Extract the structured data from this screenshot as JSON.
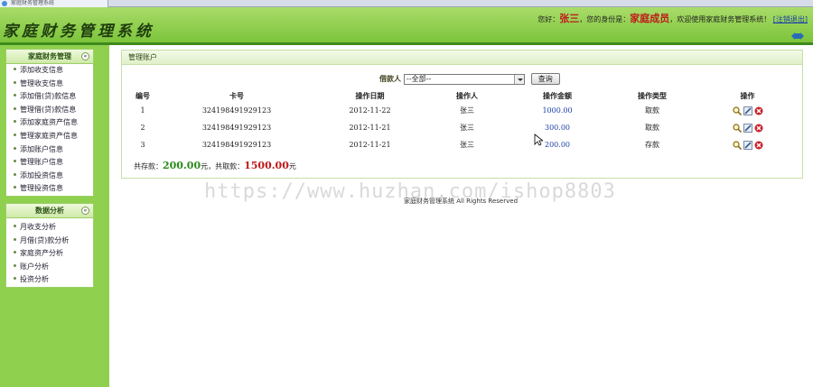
{
  "window": {
    "tab_title": "家庭财务管理系统"
  },
  "header": {
    "logo": "家庭财务管理系统",
    "greeting_prefix": "您好：",
    "username": "张三",
    "role_prefix": "，您的身份是：",
    "role": "家庭成员",
    "welcome": "，欢迎使用家庭财务管理系统！",
    "logout": "[注销退出]"
  },
  "sidebar": {
    "groups": [
      {
        "title": "家庭财务管理",
        "items": [
          "添加收支信息",
          "管理收支信息",
          "添加借(贷)款信息",
          "管理借(贷)款信息",
          "添加家庭资产信息",
          "管理家庭资产信息",
          "添加账户信息",
          "管理账户信息",
          "添加投资信息",
          "管理投资信息"
        ]
      },
      {
        "title": "数据分析",
        "items": [
          "月收支分析",
          "月借(贷)款分析",
          "家庭资产分析",
          "账户分析",
          "投资分析"
        ]
      }
    ]
  },
  "main": {
    "title": "管理账户",
    "search": {
      "label": "借款人",
      "selected": "--全部--",
      "button": "查询"
    },
    "columns": [
      "编号",
      "卡号",
      "操作日期",
      "操作人",
      "操作金额",
      "操作类型",
      "操作"
    ],
    "rows": [
      {
        "id": "1",
        "card": "324198491929123",
        "date": "2012-11-22",
        "operator": "张三",
        "amount": "1000.00",
        "type": "取款"
      },
      {
        "id": "2",
        "card": "324198491929123",
        "date": "2012-11-21",
        "operator": "张三",
        "amount": "300.00",
        "type": "取款"
      },
      {
        "id": "3",
        "card": "324198491929123",
        "date": "2012-11-21",
        "operator": "张三",
        "amount": "200.00",
        "type": "存款"
      }
    ],
    "summary": {
      "deposit_label": "共存款：",
      "deposit_value": "200.00",
      "unit1": "元，",
      "withdraw_label": "共取款：",
      "withdraw_value": "1500.00",
      "unit2": "元"
    }
  },
  "footer": "家庭财务管理系统 All Rights Reserved",
  "watermark": "https://www.huzhan.com/ishop8803",
  "colors": {
    "header_green": "#8fd04e",
    "accent_red": "#c0191a",
    "accent_green": "#2a8a1a",
    "amount_blue": "#1a3fa6"
  }
}
